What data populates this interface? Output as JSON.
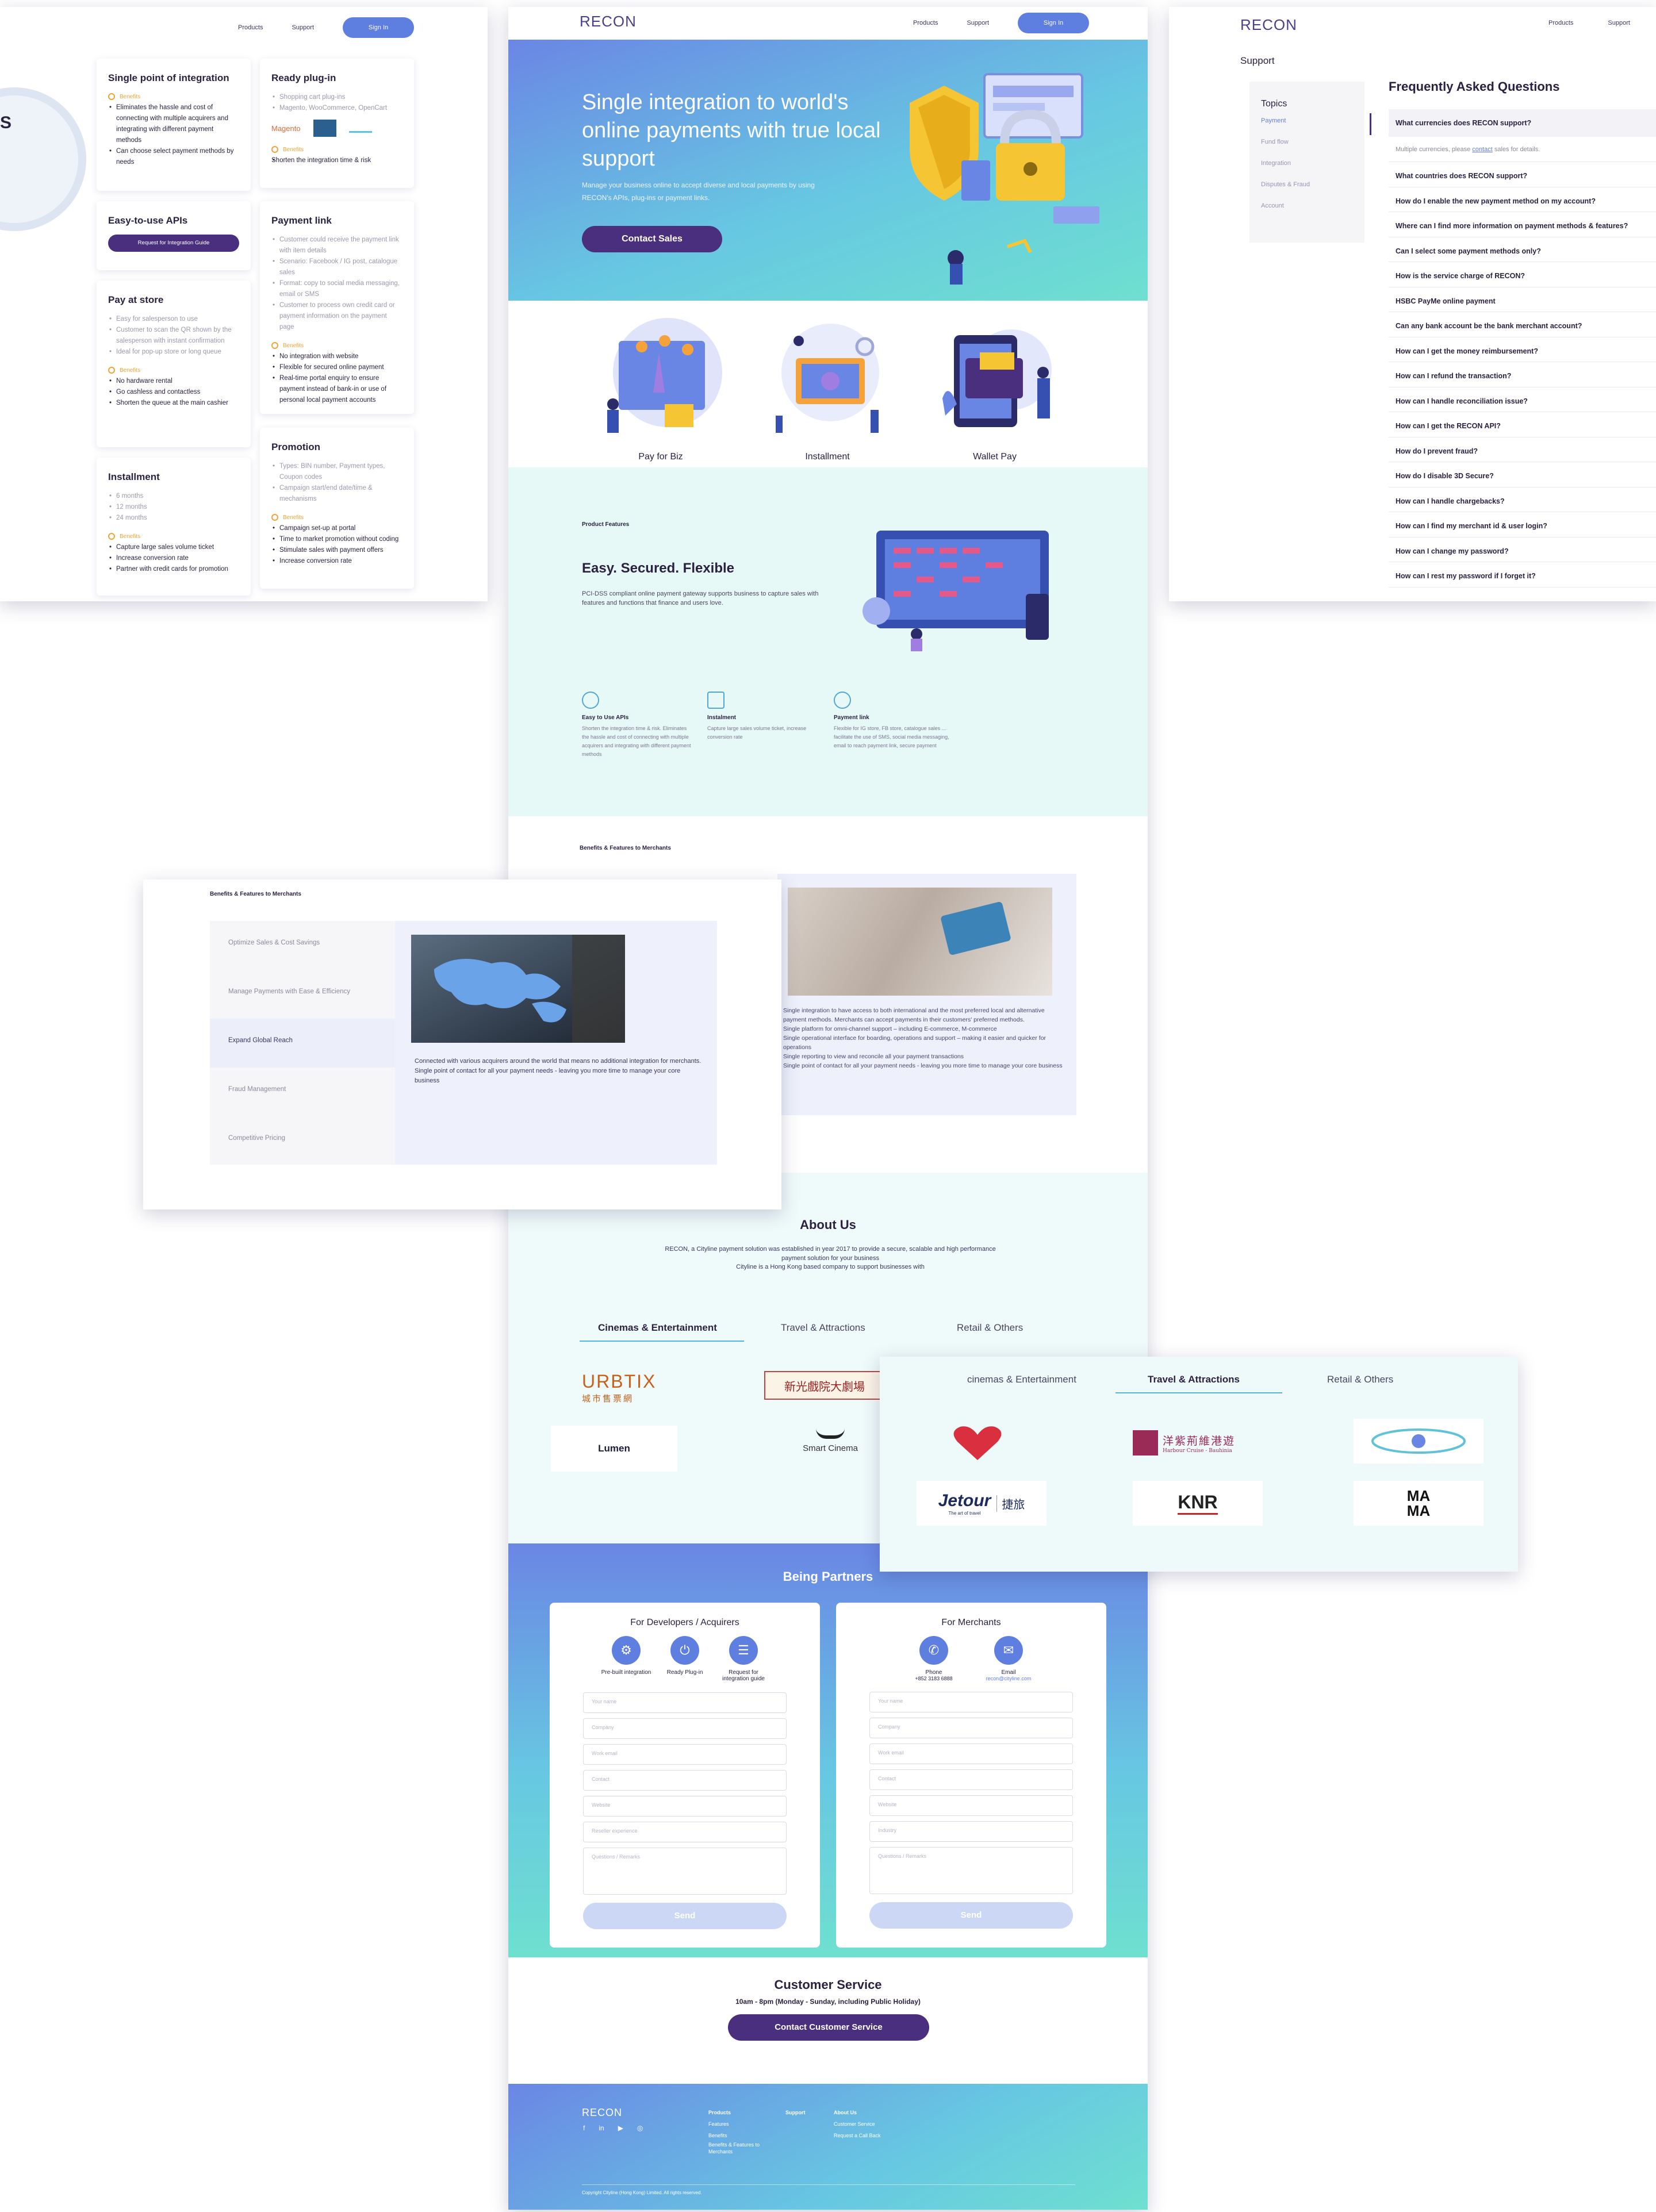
{
  "nav": {
    "products": "Products",
    "support": "Support",
    "signin": "Sign In"
  },
  "brand": "RECON",
  "left_panel": {
    "circle_letter": "S",
    "cards": [
      {
        "title": "Single point of integration",
        "top": [],
        "benefits_label": "Benefits",
        "benefits": [
          "Eliminates the hassle and cost of connecting with multiple acquirers and integrating with different payment methods",
          "Can choose select payment methods by needs"
        ]
      },
      {
        "title": "Ready plug-in",
        "top": [
          "Shopping cart plug-ins",
          "Magento, WooCommerce, OpenCart"
        ],
        "logos": [
          "Magento"
        ],
        "benefits_label": "Benefits",
        "benefits": [
          "Shorten the integration time & risk"
        ]
      },
      {
        "title": "Easy-to-use APIs",
        "button": "Request for Integration Guide"
      },
      {
        "title": "Payment link",
        "top": [
          "Customer could receive the payment link with item details",
          "Scenario: Facebook / IG post, catalogue sales",
          "Format: copy to social media messaging, email or SMS",
          "Customer to process own credit card or payment information on the payment page"
        ],
        "benefits_label": "Benefits",
        "benefits": [
          "No integration with website",
          "Flexible for secured online payment",
          "Real-time portal enquiry to ensure payment instead of bank-in or use of personal local payment accounts"
        ]
      },
      {
        "title": "Pay at store",
        "top": [
          "Easy for salesperson to use",
          "Customer to scan the QR shown by the salesperson with instant confirmation",
          "Ideal for pop-up store or long queue"
        ],
        "benefits_label": "Benefits",
        "benefits": [
          "No hardware rental",
          "Go cashless and contactless",
          "Shorten the queue at the main cashier"
        ]
      },
      {
        "title": "Promotion",
        "top": [
          "Types: BIN number, Payment types, Coupon codes",
          "Campaign start/end date/time & mechanisms"
        ],
        "benefits_label": "Benefits",
        "benefits": [
          "Campaign set-up at portal",
          "Time to market promotion without coding",
          "Stimulate sales with payment offers",
          "Increase conversion rate"
        ]
      },
      {
        "title": "Installment",
        "top": [
          "6 months",
          "12 months",
          "24 months"
        ],
        "benefits_label": "Benefits",
        "benefits": [
          "Capture large sales volume ticket",
          "Increase conversion rate",
          "Partner with credit cards for promotion"
        ]
      }
    ]
  },
  "hero": {
    "title": "Single integration to world's online payments with true local support",
    "subtitle": "Manage your business online to accept diverse and local payments by using RECON's APIs, plug-ins or payment links.",
    "cta": "Contact Sales"
  },
  "products": [
    {
      "label": "Pay for Biz"
    },
    {
      "label": "Installment"
    },
    {
      "label": "Wallet Pay"
    }
  ],
  "features": {
    "eyebrow": "Product Features",
    "title": "Easy. Secured. Flexible",
    "desc": "PCI-DSS compliant online payment gateway supports business to capture sales with features and functions that finance and users love.",
    "items": [
      {
        "title": "Easy to Use APIs",
        "desc": "Shorten the integration time & risk. Eliminates the hassle and cost of connecting with multiple acquirers and integrating with different payment methods"
      },
      {
        "title": "Instalment",
        "desc": "Capture large sales volume ticket, increase conversion rate"
      },
      {
        "title": "Payment link",
        "desc": "Flexible for IG store, FB store, catalogue sales ... facilitate the use of SMS, social media messaging, email to reach payment link, secure payment"
      }
    ]
  },
  "benefits_heading": "Benefits & Features to Merchants",
  "benefits_main": {
    "bullets": [
      "Single integration to have access to both international and the most preferred local and alternative payment methods. Merchants can accept payments in their customers' preferred methods.",
      "Single platform for omni-channel support – including E-commerce, M-commerce",
      "Single operational interface for boarding, operations and support – making it easier and quicker for operations",
      "Single reporting to view and reconcile all your payment transactions",
      "Single point of contact for all your payment needs - leaving you more time to manage your core business"
    ]
  },
  "benefits_overlay": {
    "heading": "Benefits & Features to Merchants",
    "items": [
      "Optimize Sales & Cost Savings",
      "Manage Payments with Ease & Efficiency",
      "Expand Global Reach",
      "Fraud Management",
      "Competitive Pricing"
    ],
    "active": "Expand Global Reach",
    "bullet": "Connected with various acquirers around the world that means no additional integration for merchants. Single point of contact for all your payment needs - leaving you more time to manage your core business"
  },
  "about": {
    "title": "About Us",
    "text1": "RECON, a Cityline payment solution was established in year 2017 to provide a secure, scalable and high performance payment solution for your business",
    "text2": "Cityline is a Hong Kong based company to support businesses with",
    "tabs": [
      "Cinemas & Entertainment",
      "Travel & Attractions",
      "Retail & Others"
    ],
    "logos": [
      "URBTIX",
      "城市售票網",
      "新光戲院大劇場",
      "Lumen",
      "Smart Cinema"
    ]
  },
  "travel_overlay": {
    "tabs": [
      "cinemas & Entertainment",
      "Travel & Attractions",
      "Retail & Others"
    ],
    "logos": [
      "Jetour",
      "The art of travel",
      "捷旅",
      "KNR",
      "MA MA",
      "洋紫荊維港遊",
      "Harbour Cruise - Bauhinia"
    ]
  },
  "partners": {
    "title": "Being Partners",
    "dev": {
      "title": "For Developers / Acquirers",
      "icons": [
        "Pre-built integration",
        "Ready Plug-in",
        "Request for integration guide"
      ],
      "fields": [
        "Your name",
        "Company",
        "Work email",
        "Contact",
        "Website",
        "Reseller experience",
        "Questions / Remarks"
      ],
      "send": "Send"
    },
    "mer": {
      "title": "For Merchants",
      "phone_label": "Phone",
      "phone": "+852 3183 6888",
      "email_label": "Email",
      "email": "recon@cityline.com",
      "fields": [
        "Your name",
        "Company",
        "Work email",
        "Contact",
        "Website",
        "Industry",
        "Questions / Remarks"
      ],
      "send": "Send"
    }
  },
  "customer_service": {
    "title": "Customer Service",
    "hours": "10am - 8pm (Monday - Sunday, including Public Holiday)",
    "cta": "Contact Customer Service"
  },
  "footer": {
    "cols": [
      {
        "title": "Products",
        "links": [
          "Features",
          "Benefits",
          "Benefits & Features to Merchants"
        ]
      },
      {
        "title": "Support",
        "links": []
      },
      {
        "title": "About Us",
        "links": [
          "Customer Service",
          "Request a Call Back"
        ]
      }
    ],
    "copyright": "Copyright Cityline (Hong Kong) Limited.  All rights reserved."
  },
  "support": {
    "title": "Support",
    "topics_title": "Topics",
    "topics": [
      "Payment",
      "Fund flow",
      "Integration",
      "Disputes & Fraud",
      "Account"
    ],
    "faq_title": "Frequently Asked Questions",
    "first_q": "What currencies does RECON support?",
    "first_a_pre": "Multiple currencies, please ",
    "first_a_link": "contact",
    "first_a_post": " sales for details.",
    "faqs": [
      "What countries does RECON support?",
      "How do I enable the new payment method on my account?",
      "Where can I find more information on payment methods & features?",
      "Can I select some payment methods only?",
      "How is the service charge of RECON?",
      "HSBC PayMe online payment",
      "Can any bank account be the bank merchant account?",
      "How can I get the money reimbursement?",
      "How can I refund the transaction?",
      "How can I handle reconciliation issue?",
      "How can I get the RECON API?",
      "How do I prevent fraud?",
      "How do I disable 3D Secure?",
      "How can I handle chargebacks?",
      "How can I find my merchant id & user login?",
      "How can I change my password?",
      "How can I rest my password if I forget it?"
    ]
  },
  "colors": {
    "accent": "#5f7fe0",
    "dark_purple": "#4a2f7e",
    "teal": "#6ee0cf",
    "orange": "#f0a336"
  }
}
